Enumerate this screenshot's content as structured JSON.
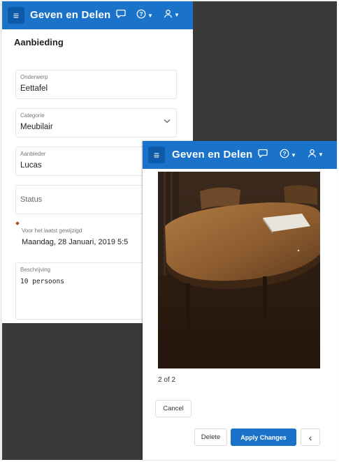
{
  "app": {
    "title": "Geven en Delen",
    "menu_icon": "hamburger-icon",
    "chat_icon": "chat-bubble-icon",
    "help_icon": "help-circle-icon",
    "user_icon": "user-icon",
    "brand_color": "#1a73c8"
  },
  "form": {
    "page_title": "Aanbieding",
    "onderwerp": {
      "label": "Onderwerp",
      "value": "Eettafel"
    },
    "categorie": {
      "label": "Categorie",
      "value": "Meubilair"
    },
    "aanbieder": {
      "label": "Aanbieder",
      "value": "Lucas"
    },
    "status": {
      "placeholder": "Status"
    },
    "modified": {
      "label": "Voor het laatst gewijzigd",
      "value": "Maandag, 28 Januari, 2019 5:5"
    },
    "beschrijving": {
      "label": "Beschrijving",
      "value": "10 persoons"
    }
  },
  "viewer": {
    "counter": "2 of 2",
    "cancel_label": "Cancel",
    "delete_label": "Delete",
    "apply_label": "Apply Changes",
    "back_glyph": "‹"
  }
}
